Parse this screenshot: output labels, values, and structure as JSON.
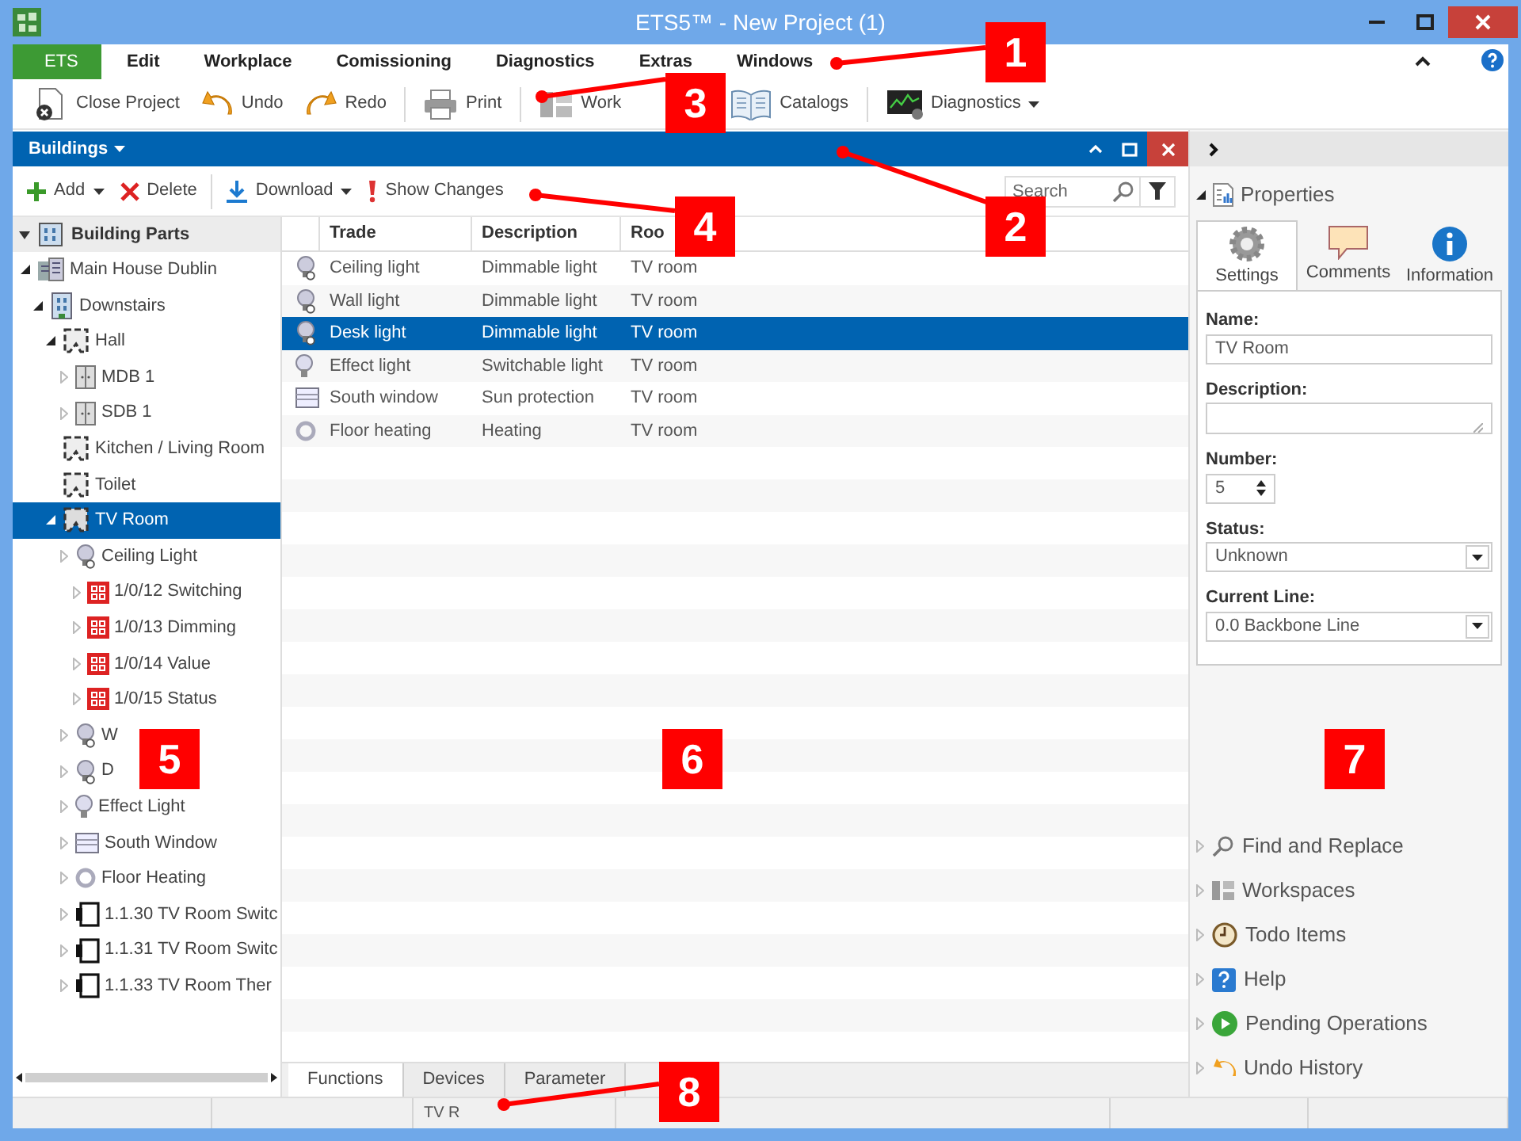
{
  "window": {
    "title": "ETS5™ - New Project (1)"
  },
  "menu": [
    {
      "label": "ETS",
      "kind": "app"
    },
    {
      "label": "Edit",
      "kind": "menu"
    },
    {
      "label": "Workplace",
      "kind": "menu"
    },
    {
      "label": "Comissioning",
      "kind": "menu"
    },
    {
      "label": "Diagnostics",
      "kind": "menu"
    },
    {
      "label": "Extras",
      "kind": "menu"
    },
    {
      "label": "Windows",
      "kind": "menu"
    }
  ],
  "toolbar": [
    {
      "label": "Close Project",
      "dropdown": false
    },
    {
      "label": "Undo",
      "dropdown": false
    },
    {
      "label": "Redo",
      "dropdown": false
    },
    {
      "label": "Print",
      "dropdown": false
    },
    {
      "label": "Work",
      "dropdown": false
    },
    {
      "label": "Catalogs",
      "dropdown": false
    },
    {
      "label": "Diagnostics",
      "dropdown": true
    }
  ],
  "panel": {
    "title": "Buildings",
    "toolbar": [
      {
        "label": "Add",
        "dropdown": true
      },
      {
        "label": "Delete",
        "dropdown": false
      },
      {
        "label": "Download",
        "dropdown": true
      },
      {
        "label": "Show Changes",
        "dropdown": false
      }
    ],
    "search": {
      "placeholder": "Search"
    }
  },
  "tree": {
    "header": {
      "label": "Building Parts",
      "expanded": true
    },
    "nodes": [
      {
        "label": "Main House Dublin",
        "kind": "building",
        "expanded": true,
        "selected": false,
        "children": [
          {
            "label": "Downstairs",
            "kind": "floor",
            "expanded": true,
            "selected": false,
            "children": [
              {
                "label": "Hall",
                "kind": "room",
                "expanded": true,
                "selected": false,
                "children": [
                  {
                    "label": "MDB 1",
                    "kind": "cabinet",
                    "expanded": false,
                    "selected": false
                  },
                  {
                    "label": "SDB 1",
                    "kind": "cabinet",
                    "expanded": false,
                    "selected": false
                  }
                ]
              },
              {
                "label": "Kitchen / Living Room",
                "kind": "room",
                "selected": false
              },
              {
                "label": "Toilet",
                "kind": "room",
                "selected": false
              },
              {
                "label": "TV Room",
                "kind": "room",
                "expanded": true,
                "selected": true,
                "children": [
                  {
                    "label": "Ceiling Light",
                    "kind": "lamp",
                    "expanded": false,
                    "selected": false,
                    "children": [
                      {
                        "label": "1/0/12 Switching",
                        "kind": "group-address",
                        "expanded": false,
                        "selected": false
                      },
                      {
                        "label": "1/0/13 Dimming",
                        "kind": "group-address",
                        "expanded": false,
                        "selected": false
                      },
                      {
                        "label": "1/0/14 Value",
                        "kind": "group-address",
                        "expanded": false,
                        "selected": false
                      },
                      {
                        "label": "1/0/15 Status",
                        "kind": "group-address",
                        "expanded": false,
                        "selected": false
                      }
                    ]
                  },
                  {
                    "label": "W",
                    "kind": "lamp",
                    "expanded": false,
                    "selected": false
                  },
                  {
                    "label": "D",
                    "kind": "lamp",
                    "expanded": false,
                    "selected": false
                  },
                  {
                    "label": "Effect Light",
                    "kind": "bulb",
                    "expanded": false,
                    "selected": false
                  },
                  {
                    "label": "South Window",
                    "kind": "blind",
                    "expanded": false,
                    "selected": false
                  },
                  {
                    "label": "Floor Heating",
                    "kind": "heating",
                    "expanded": false,
                    "selected": false
                  },
                  {
                    "label": "1.1.30 TV Room Switc",
                    "kind": "device",
                    "expanded": false,
                    "selected": false
                  },
                  {
                    "label": "1.1.31 TV Room Switc",
                    "kind": "device",
                    "expanded": false,
                    "selected": false
                  },
                  {
                    "label": "1.1.33 TV Room Ther",
                    "kind": "device",
                    "expanded": false,
                    "selected": false
                  }
                ]
              }
            ]
          }
        ]
      }
    ]
  },
  "table": {
    "columns": [
      "Trade",
      "Description",
      "Roo"
    ],
    "rows": [
      {
        "kind": "lamp",
        "cells": [
          "Ceiling light",
          "Dimmable light",
          "TV room"
        ],
        "selected": false
      },
      {
        "kind": "lamp",
        "cells": [
          "Wall light",
          "Dimmable light",
          "TV room"
        ],
        "selected": false
      },
      {
        "kind": "lamp",
        "cells": [
          "Desk light",
          "Dimmable light",
          "TV room"
        ],
        "selected": true
      },
      {
        "kind": "bulb",
        "cells": [
          "Effect light",
          "Switchable light",
          "TV room"
        ],
        "selected": false
      },
      {
        "kind": "blind",
        "cells": [
          "South window",
          "Sun protection",
          "TV room"
        ],
        "selected": false
      },
      {
        "kind": "heating",
        "cells": [
          "Floor heating",
          "Heating",
          "TV room"
        ],
        "selected": false
      }
    ]
  },
  "bottom_tabs": [
    {
      "label": "Functions",
      "selected": true
    },
    {
      "label": "Devices",
      "selected": false
    },
    {
      "label": "Parameter",
      "selected": false
    }
  ],
  "properties": {
    "title": "Properties",
    "expanded": true,
    "tabs": [
      {
        "label": "Settings",
        "selected": true
      },
      {
        "label": "Comments",
        "selected": false
      },
      {
        "label": "Information",
        "selected": false
      }
    ],
    "fields": [
      {
        "kind": "text",
        "label": "Name:",
        "value": "TV Room"
      },
      {
        "kind": "textarea",
        "label": "Description:"
      },
      {
        "kind": "spin",
        "label": "Number:",
        "value": "5"
      },
      {
        "kind": "select",
        "label": "Status:",
        "value": "Unknown"
      },
      {
        "kind": "select",
        "label": "Current Line:",
        "value": "0.0 Backbone Line"
      }
    ]
  },
  "sections": [
    {
      "label": "Find and Replace",
      "expanded": false
    },
    {
      "label": "Workspaces",
      "expanded": false
    },
    {
      "label": "Todo Items",
      "expanded": false
    },
    {
      "label": "Help",
      "expanded": false
    },
    {
      "label": "Pending Operations",
      "expanded": false
    },
    {
      "label": "Undo History",
      "expanded": false
    }
  ],
  "status_bar": {
    "text": "TV R"
  },
  "callouts": [
    {
      "number": "1"
    },
    {
      "number": "2"
    },
    {
      "number": "3"
    },
    {
      "number": "4"
    },
    {
      "number": "5"
    },
    {
      "number": "6"
    },
    {
      "number": "7"
    },
    {
      "number": "8"
    }
  ]
}
